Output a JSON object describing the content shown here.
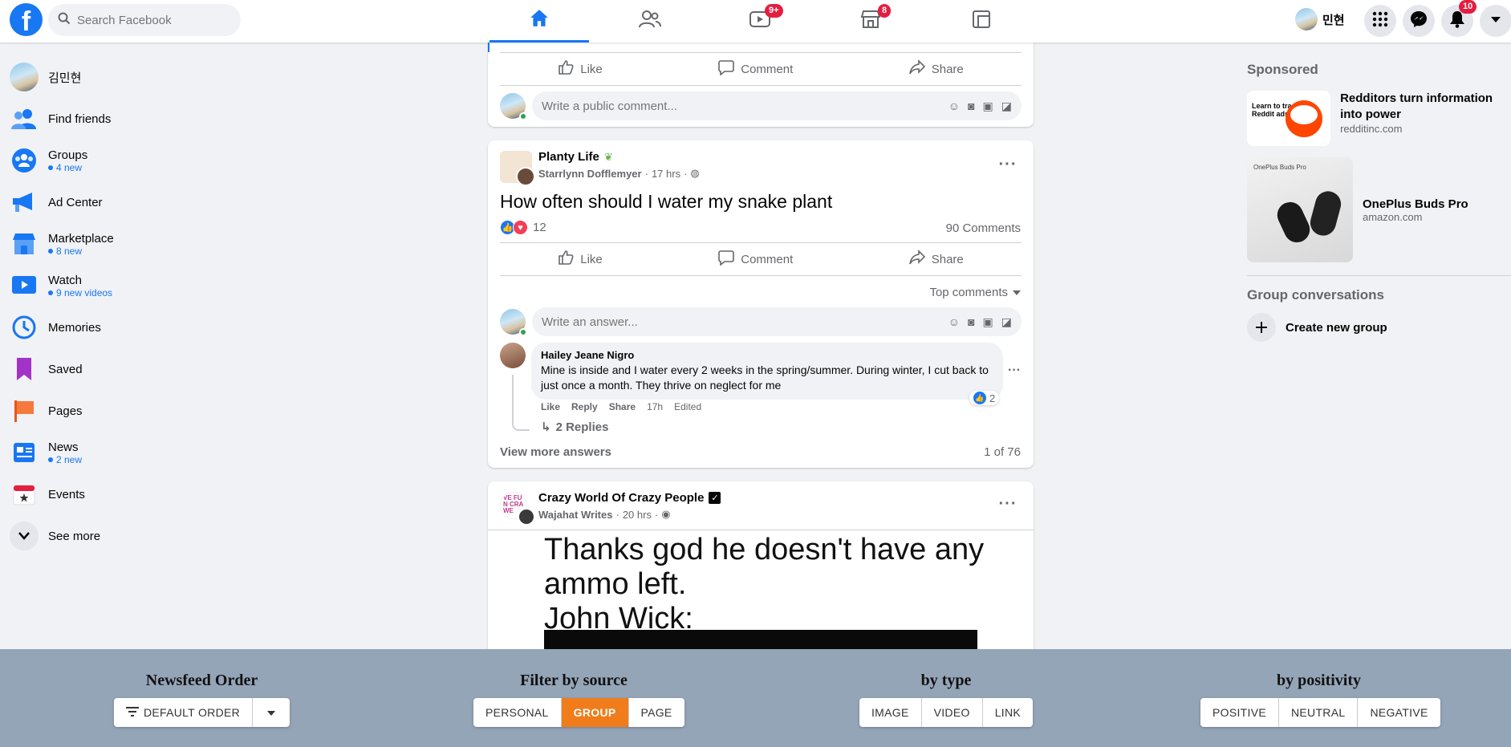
{
  "topbar": {
    "logo": "f",
    "search_placeholder": "Search Facebook",
    "nav": [
      {
        "name": "home-icon",
        "badge": ""
      },
      {
        "name": "friends-icon",
        "badge": ""
      },
      {
        "name": "watch-icon",
        "badge": "9+"
      },
      {
        "name": "marketplace-icon",
        "badge": "8"
      },
      {
        "name": "gaming-icon",
        "badge": ""
      }
    ],
    "profile_name": "민현",
    "notifications_badge": "10",
    "accent": "#1877f2"
  },
  "sidebar": {
    "items": [
      {
        "label": "김민현",
        "sub": ""
      },
      {
        "label": "Find friends",
        "sub": ""
      },
      {
        "label": "Groups",
        "sub": "4 new"
      },
      {
        "label": "Ad Center",
        "sub": ""
      },
      {
        "label": "Marketplace",
        "sub": "8 new"
      },
      {
        "label": "Watch",
        "sub": "9 new videos"
      },
      {
        "label": "Memories",
        "sub": ""
      },
      {
        "label": "Saved",
        "sub": ""
      },
      {
        "label": "Pages",
        "sub": ""
      },
      {
        "label": "News",
        "sub": "2 new"
      },
      {
        "label": "Events",
        "sub": ""
      },
      {
        "label": "See more",
        "sub": ""
      }
    ]
  },
  "feed": {
    "top_card": {
      "like": "Like",
      "comment": "Comment",
      "share": "Share",
      "comment_placeholder": "Write a public comment..."
    },
    "post1": {
      "group": "Planty Life",
      "author": "Starrlynn Dofflemyer",
      "time": "17 hrs",
      "text": "How often should I water my snake plant",
      "reactions_count": "12",
      "comments_count": "90 Comments",
      "like": "Like",
      "comment": "Comment",
      "share": "Share",
      "sort": "Top comments",
      "answer_placeholder": "Write an answer...",
      "reply": {
        "author": "Hailey Jeane Nigro",
        "text": "Mine is inside and I water every 2 weeks in the spring/summer. During winter, I cut back to just once a month. They thrive on neglect for me",
        "like": "Like",
        "reply": "Reply",
        "share": "Share",
        "time": "17h",
        "edited": "Edited",
        "reactions": "2",
        "replies": "2 Replies"
      },
      "view_more": "View more answers",
      "pager": "1 of 76"
    },
    "post2": {
      "page": "Crazy World Of Crazy People",
      "author": "Wajahat Writes",
      "time": "20 hrs",
      "avatar_text": "VE FUN CRA WE",
      "meme_lines": [
        "Thanks god he doesn't have any",
        "ammo left.",
        "John Wick:"
      ]
    }
  },
  "right": {
    "sponsored": "Sponsored",
    "ads": [
      {
        "title": "Redditors turn information into power",
        "domain": "redditinc.com",
        "thumb_text": "Learn to track Reddit ads"
      },
      {
        "title": "OnePlus Buds Pro",
        "domain": "amazon.com",
        "thumb_text": "OnePlus Buds Pro"
      }
    ],
    "group_conv": "Group conversations",
    "create_group": "Create new group"
  },
  "bottom_panel": {
    "order": {
      "title": "Newsfeed Order",
      "value": "DEFAULT ORDER"
    },
    "source": {
      "title": "Filter by source",
      "options": [
        "PERSONAL",
        "GROUP",
        "PAGE"
      ],
      "selected": "GROUP"
    },
    "type": {
      "title": "by type",
      "options": [
        "IMAGE",
        "VIDEO",
        "LINK"
      ]
    },
    "positivity": {
      "title": "by positivity",
      "options": [
        "POSITIVE",
        "NEUTRAL",
        "NEGATIVE"
      ]
    },
    "selected_color": "#f07c1b"
  }
}
